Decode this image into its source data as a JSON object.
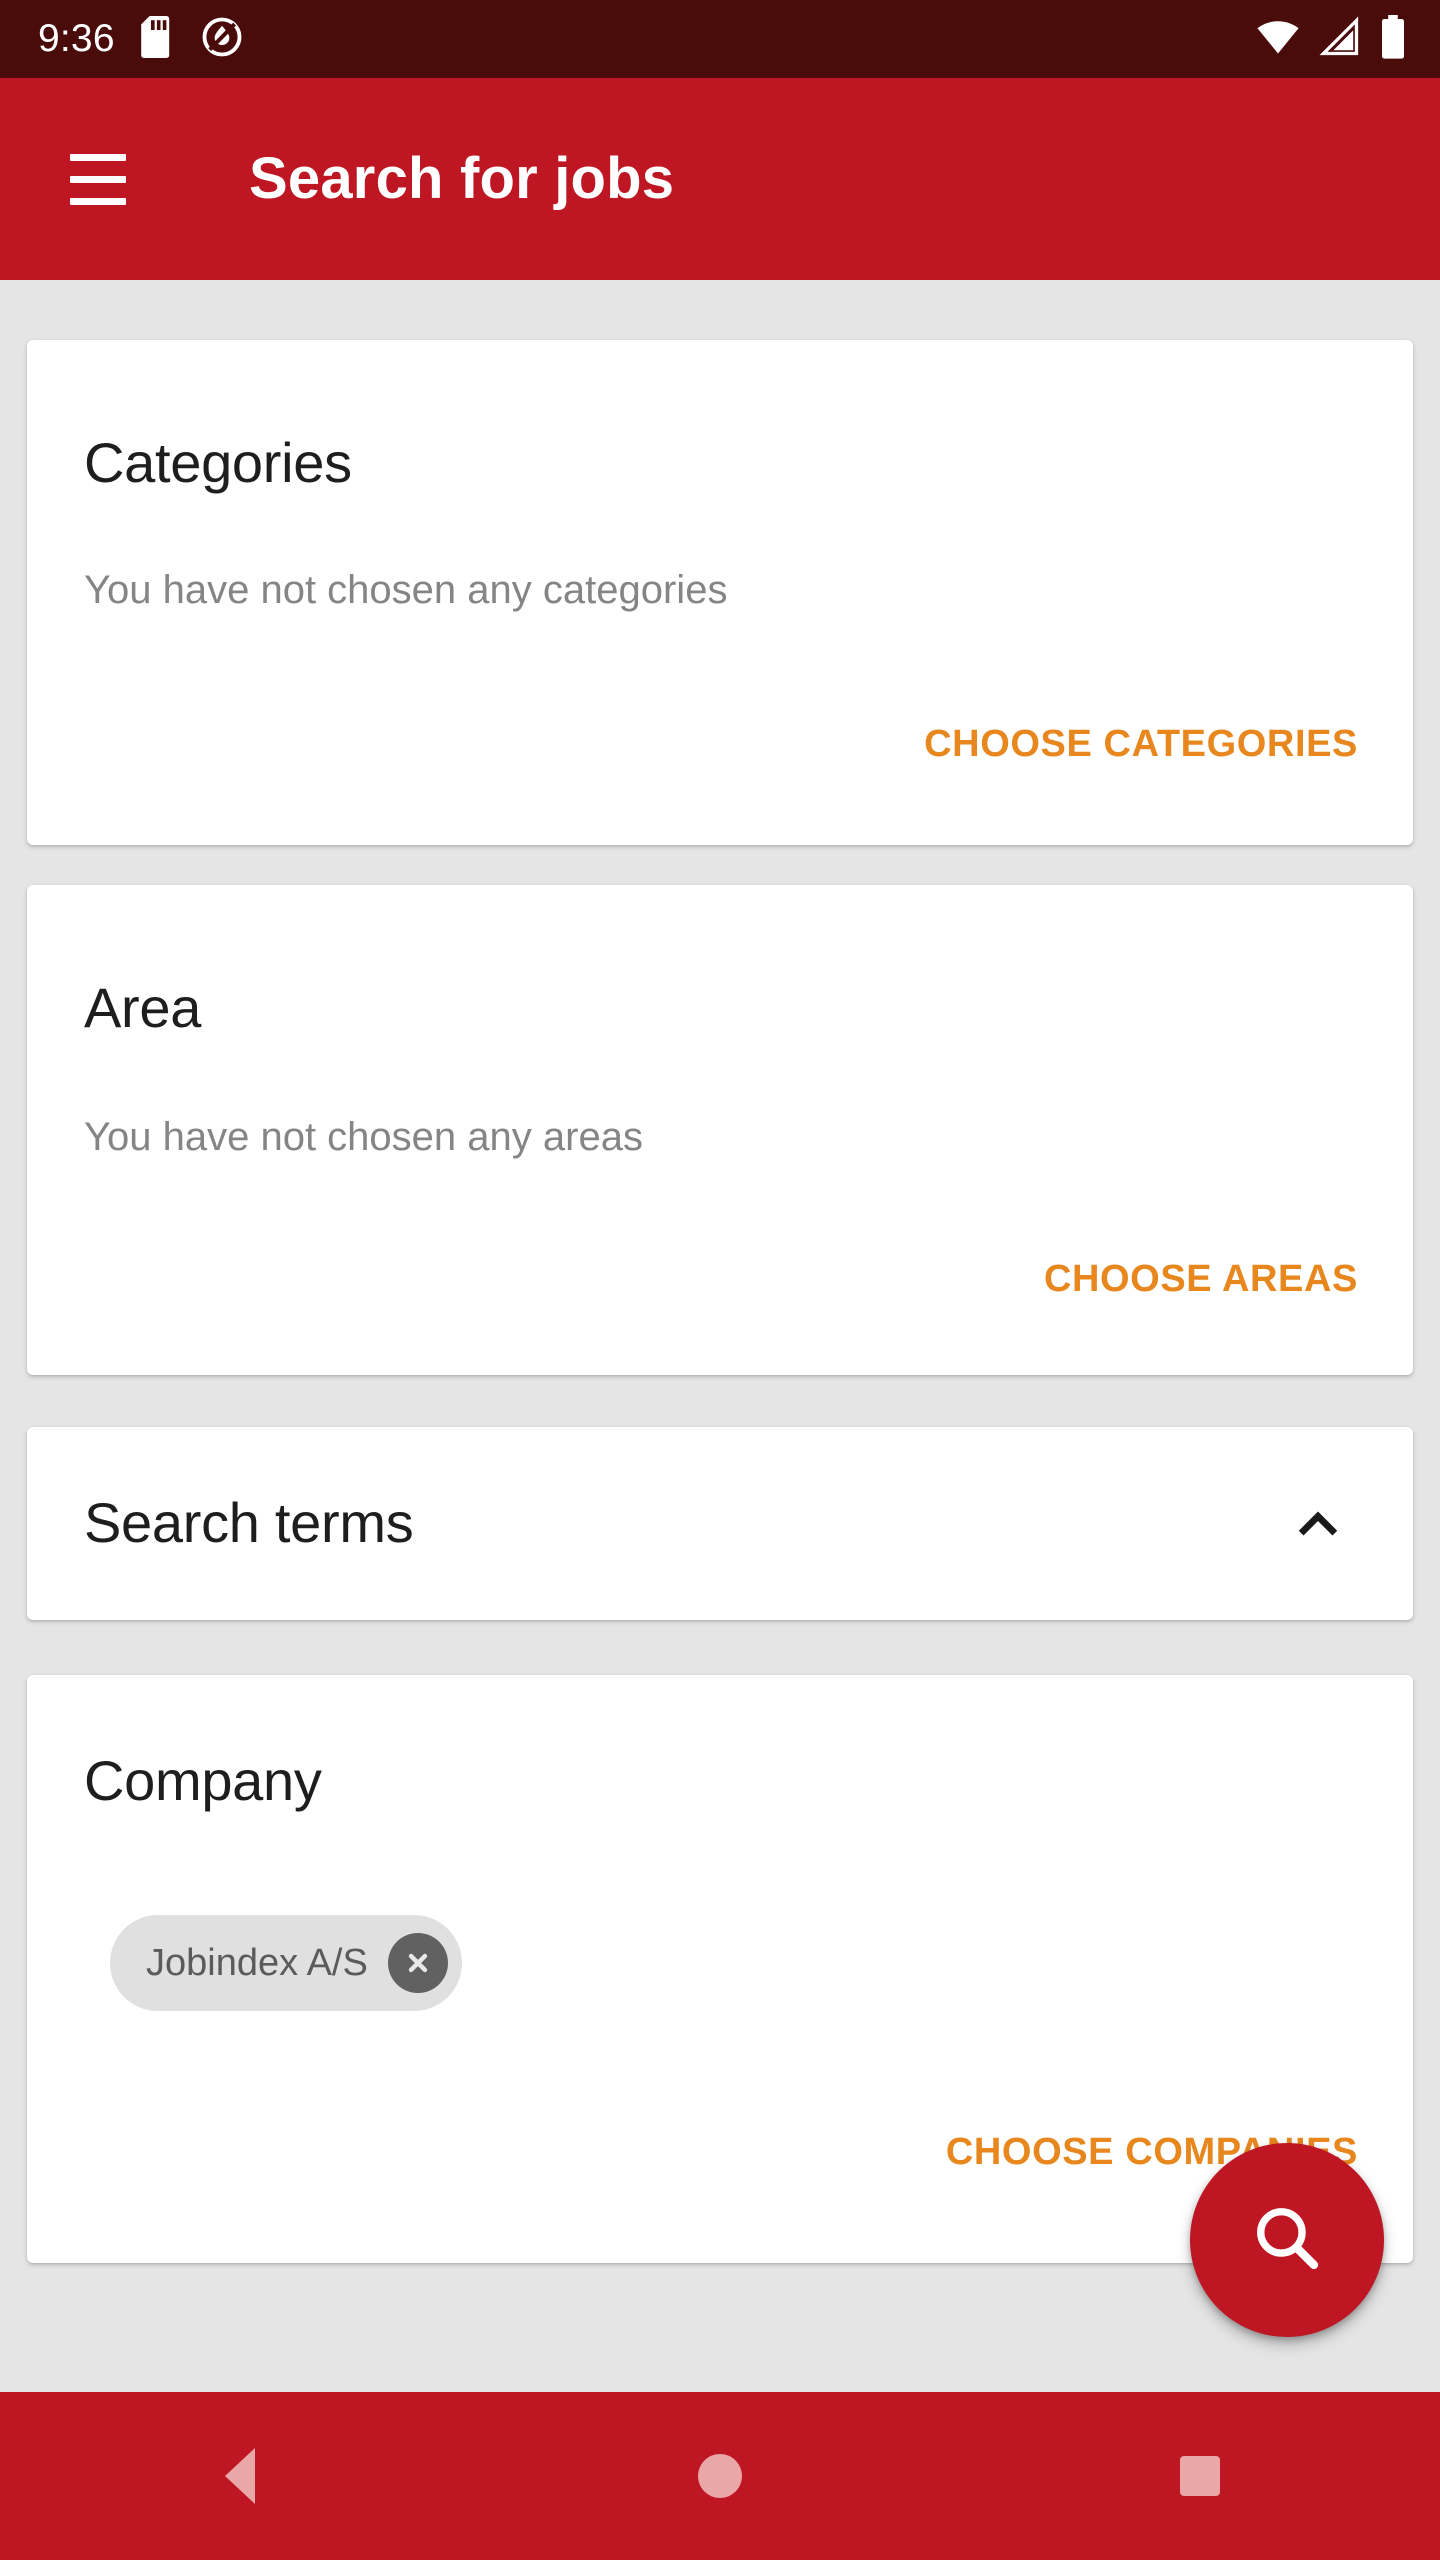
{
  "status_bar": {
    "clock": "9:36",
    "icons": [
      "sd-card-icon",
      "do-not-disturb-icon",
      "wifi-icon",
      "cellular-signal-icon",
      "battery-icon"
    ],
    "background_color": "#4A0B0B"
  },
  "app_bar": {
    "menu_icon": "hamburger-menu-icon",
    "title": "Search for jobs",
    "background_color": "#BE1622",
    "text_color": "#FFFFFF"
  },
  "theme": {
    "primary_red": "#BE1622",
    "accent_orange": "#E8871E",
    "page_background": "#E5E5E5",
    "card_background": "#FFFFFF",
    "chip_background": "#E0E0E0",
    "chip_close_background": "#616161",
    "subtitle_gray": "#858585"
  },
  "cards": {
    "categories": {
      "title": "Categories",
      "subtitle": "You have not chosen any categories",
      "action_label": "CHOOSE CATEGORIES"
    },
    "area": {
      "title": "Area",
      "subtitle": "You have not chosen any areas",
      "action_label": "CHOOSE AREAS"
    },
    "search_terms": {
      "title": "Search terms",
      "toggle_icon": "chevron-up-icon",
      "expanded": true
    },
    "company": {
      "title": "Company",
      "chips": [
        {
          "label": "Jobindex A/S",
          "remove_icon": "close-icon"
        }
      ],
      "action_label": "CHOOSE COMPANIES"
    }
  },
  "fab": {
    "icon": "search-icon",
    "color": "#BE1622"
  },
  "nav_bar": {
    "background_color": "#BE1622",
    "buttons": [
      {
        "name": "back",
        "icon": "triangle-back-icon"
      },
      {
        "name": "home",
        "icon": "circle-home-icon"
      },
      {
        "name": "recents",
        "icon": "square-recents-icon"
      }
    ]
  }
}
